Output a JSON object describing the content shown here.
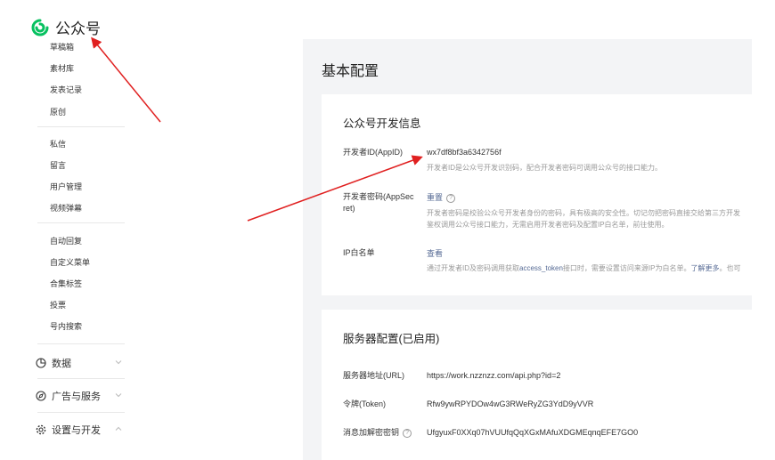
{
  "app": {
    "name": "公众号",
    "brand_color": "#07c160"
  },
  "sidebar": {
    "items_top": [
      "草稿箱",
      "素材库",
      "发表记录",
      "原创"
    ],
    "items_mid": [
      "私信",
      "留言",
      "用户管理",
      "视频弹幕"
    ],
    "items_bottom": [
      "自动回复",
      "自定义菜单",
      "合集标签",
      "投票",
      "号内搜索"
    ],
    "sections": [
      {
        "label": "数据",
        "icon": "chart-icon"
      },
      {
        "label": "广告与服务",
        "icon": "compass-icon"
      },
      {
        "label": "设置与开发",
        "icon": "gear-icon"
      }
    ]
  },
  "main": {
    "title": "基本配置",
    "dev_info": {
      "title": "公众号开发信息",
      "appid_label": "开发者ID(AppID)",
      "appid_value": "wx7df8bf3a6342756f",
      "appid_desc": "开发者ID是公众号开发识别码，配合开发者密码可调用公众号的接口能力。",
      "secret_label_1": "开发者密码(AppSec",
      "secret_label_2": "ret)",
      "secret_action": "重置",
      "secret_desc_1": "开发者密码是校验公众号开发者身份的密码，具有极高的安全性。切记勿把密码直接交给第三方开发",
      "secret_desc_2": "鉴权调用公众号接口能力，无需启用开发者密码及配置IP白名单，前往使用。",
      "ip_label": "IP白名单",
      "ip_action": "查看",
      "ip_desc_prefix": "通过开发者ID及密码调用获取",
      "ip_desc_link": "access_token",
      "ip_desc_mid": "接口时，需要设置访问来源IP为白名单。",
      "ip_desc_more": "了解更多",
      "ip_desc_tail": "。也可"
    },
    "server": {
      "title": "服务器配置(已启用)",
      "url_label": "服务器地址(URL)",
      "url_value": "https://work.nzznzz.com/api.php?id=2",
      "token_label": "令牌(Token)",
      "token_value": "Rfw9ywRPYDOw4wG3RWeRyZG3YdD9yVVR",
      "aes_label": "消息加解密密钥",
      "aes_value": "UfgyuxF0XXq07hVUUfqQqXGxMAfuXDGMEqnqEFE7GO0"
    }
  },
  "annotations": {
    "arrow_color": "#e02020"
  }
}
